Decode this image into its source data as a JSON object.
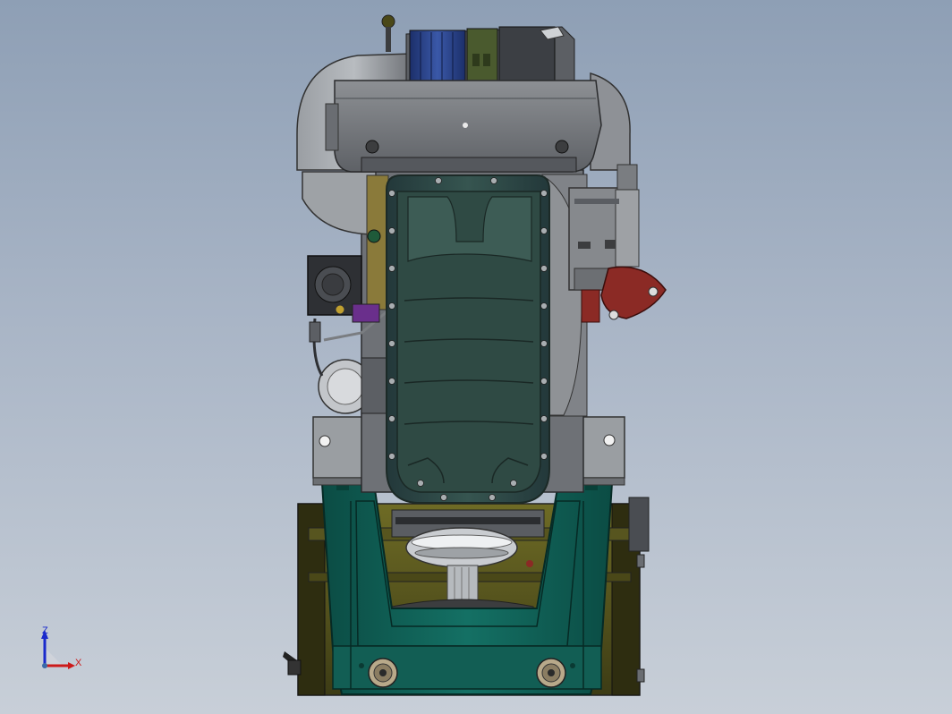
{
  "viewport": {
    "background_top": "#8e9fb5",
    "background_bottom": "#c8cfd8"
  },
  "model": {
    "view": "engine-front-view",
    "colors": {
      "body_gray": "#7b7e82",
      "dark_gray": "#4a4d52",
      "oil_pan": "#2f4a44",
      "oil_pan_edge": "#1c2a27",
      "air_filter_blue": "#233a7a",
      "stand_teal": "#0f5c52",
      "base_olive": "#4e4d1c",
      "flange_red": "#8b2a25",
      "accent_purple": "#6a2f8c",
      "olive_green": "#4a5a2e"
    }
  },
  "triad": {
    "z_label": "Z",
    "x_label": "X",
    "z_color": "#1a2acc",
    "x_color": "#cc1a1a",
    "origin_color": "#3a6aa8"
  }
}
